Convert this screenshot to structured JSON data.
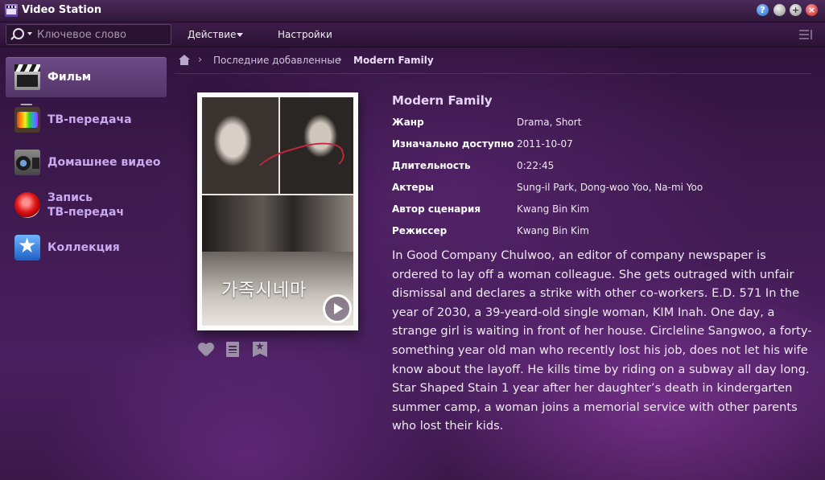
{
  "window": {
    "title": "Video Station"
  },
  "toolbar": {
    "search_placeholder": "Ключевое слово",
    "action_label": "Действие",
    "settings_label": "Настройки"
  },
  "sidebar": {
    "items": [
      {
        "label": "Фильм",
        "active": true
      },
      {
        "label": "ТВ-передача"
      },
      {
        "label": "Домашнее видео"
      },
      {
        "label_line1": "Запись",
        "label_line2": "ТВ-передач"
      },
      {
        "label": "Коллекция"
      }
    ]
  },
  "breadcrumb": {
    "items": [
      "Последние добавленные",
      "Modern Family"
    ]
  },
  "poster": {
    "title_text": "가족시네마"
  },
  "movie": {
    "title": "Modern Family",
    "details": [
      {
        "label": "Жанр",
        "value": "Drama, Short"
      },
      {
        "label": "Изначально доступно",
        "value": "2011-10-07"
      },
      {
        "label": "Длительность",
        "value": "0:22:45"
      },
      {
        "label": "Актеры",
        "value": "Sung-il Park, Dong-woo Yoo, Na-mi Yoo"
      },
      {
        "label": "Автор сценария",
        "value": "Kwang Bin Kim"
      },
      {
        "label": "Режиссер",
        "value": "Kwang Bin Kim"
      }
    ],
    "synopsis": "In Good Company Chulwoo, an editor of company newspaper is ordered to lay off a woman colleague. She gets outraged with unfair dismissal and declares a strike with other co-workers. E.D. 571 In the year of 2030, a 39-yeard-old single woman, KIM Inah. One day, a strange girl is waiting in front of her house. Circleline Sangwoo, a forty-something year old man who recently lost his job, does not let his wife know about the layoff. He kills time by riding on a subway all day long. Star Shaped Stain 1 year after her daughter’s death in kindergarten summer camp, a woman joins a memorial service with other parents who lost their kids."
  },
  "colors": {
    "accent": "#c9a9ef",
    "active_nav": "#6d4a86",
    "background": "#3e1a4e"
  }
}
